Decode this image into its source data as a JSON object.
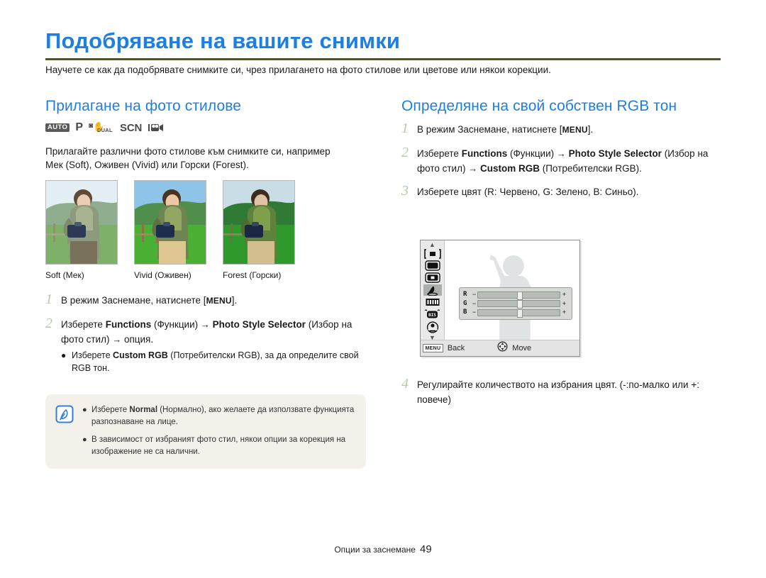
{
  "header": {
    "title": "Подобряване на вашите снимки",
    "intro": "Научете се как да подобрявате снимките си, чрез прилагането на фото стилове или цветове или някои корекции."
  },
  "left_column": {
    "section_title": "Прилагане на фото стилове",
    "modes": [
      {
        "name": "auto-mode-icon",
        "label": "AUTO"
      },
      {
        "name": "program-mode-icon",
        "label": "P"
      },
      {
        "name": "dual-is-mode-icon",
        "label": "DUAL"
      },
      {
        "name": "scene-mode-icon",
        "label": "SCN"
      },
      {
        "name": "movie-mode-icon",
        "label": ""
      }
    ],
    "description": "Прилагайте различни фото стилове към снимките си, например Мек (Soft), Оживен (Vivid) или Горски (Forest).",
    "thumbnails": [
      {
        "caption": "Soft (Мек)",
        "sky": "#e4eef5",
        "hill": "#8fae8e",
        "grass": "#7fb06a",
        "vest": "#8d9a7e",
        "skin": "#e8cdb6"
      },
      {
        "caption": "Vivid (Оживен)",
        "sky": "#8ec4e8",
        "hill": "#4f8f4b",
        "grass": "#49b033",
        "vest": "#6f8353",
        "skin": "#edc8a4"
      },
      {
        "caption": "Forest (Горски)",
        "sky": "#c8dde6",
        "hill": "#2f7a35",
        "grass": "#2f9a2b",
        "vest": "#60813e",
        "skin": "#dfc2a3"
      }
    ],
    "steps": [
      {
        "num": "1",
        "parts": [
          {
            "t": "text",
            "v": "В режим Заснемане, натиснете ["
          },
          {
            "t": "key",
            "v": "MENU"
          },
          {
            "t": "text",
            "v": "]."
          }
        ]
      },
      {
        "num": "2",
        "parts": [
          {
            "t": "text",
            "v": "Изберете "
          },
          {
            "t": "bold",
            "v": "Functions"
          },
          {
            "t": "text",
            "v": " (Функции) "
          },
          {
            "t": "arrow",
            "v": "→"
          },
          {
            "t": "text",
            "v": " "
          },
          {
            "t": "bold",
            "v": "Photo Style Selector"
          },
          {
            "t": "text",
            "v": " (Избор на фото стил) "
          },
          {
            "t": "arrow",
            "v": "→"
          },
          {
            "t": "text",
            "v": " опция."
          }
        ],
        "sub": [
          {
            "parts": [
              {
                "t": "text",
                "v": "Изберете "
              },
              {
                "t": "bold",
                "v": "Custom RGB"
              },
              {
                "t": "text",
                "v": " (Потребителски RGB), за да определите свой RGB тон."
              }
            ]
          }
        ]
      }
    ]
  },
  "note": {
    "icon": "note-pen-icon",
    "items": [
      {
        "parts": [
          {
            "t": "text",
            "v": "Изберете "
          },
          {
            "t": "bold",
            "v": "Normal"
          },
          {
            "t": "text",
            "v": " (Нормално), ако желаете да използвате функцията разпознаване на лице."
          }
        ]
      },
      {
        "parts": [
          {
            "t": "text",
            "v": "В зависимост от избраният фото стил, някои опции за корекция на изображение не са налични."
          }
        ]
      }
    ]
  },
  "right_column": {
    "section_title": "Определяне на свой собствен RGB тон",
    "steps": [
      {
        "num": "1",
        "parts": [
          {
            "t": "text",
            "v": "В режим Заснемане, натиснете ["
          },
          {
            "t": "key",
            "v": "MENU"
          },
          {
            "t": "text",
            "v": "]."
          }
        ]
      },
      {
        "num": "2",
        "parts": [
          {
            "t": "text",
            "v": "Изберете "
          },
          {
            "t": "bold",
            "v": "Functions"
          },
          {
            "t": "text",
            "v": " (Функции) "
          },
          {
            "t": "arrow",
            "v": "→"
          },
          {
            "t": "text",
            "v": " "
          },
          {
            "t": "bold",
            "v": "Photo Style Selector"
          },
          {
            "t": "text",
            "v": " (Избор на фото стил) "
          },
          {
            "t": "arrow",
            "v": "→"
          },
          {
            "t": "text",
            "v": " "
          },
          {
            "t": "bold",
            "v": "Custom RGB"
          },
          {
            "t": "text",
            "v": " (Потребителски RGB)."
          }
        ]
      },
      {
        "num": "3",
        "parts": [
          {
            "t": "text",
            "v": "Изберете цвят (R: Червено, G: Зелено, B: Синьо)."
          }
        ]
      },
      {
        "num": "4",
        "parts": [
          {
            "t": "text",
            "v": "Регулирайте количеството на избрания цвят. (-:по-малко или +: повече)"
          }
        ]
      }
    ]
  },
  "lcd": {
    "sidebar_icons": [
      "chevron-up-icon",
      "focus-frame-icon",
      "image-size-icon",
      "image-quality-icon",
      "photo-style-icon",
      "exposure-bracket-icon",
      "image-stabilizer-icon",
      "face-detection-icon",
      "chevron-down-icon"
    ],
    "selected_icon_index": 4,
    "rgb_rows": [
      {
        "label": "R",
        "minus": "−",
        "plus": "+",
        "value": 50
      },
      {
        "label": "G",
        "minus": "−",
        "plus": "+",
        "value": 50
      },
      {
        "label": "B",
        "minus": "−",
        "plus": "+",
        "value": 50
      }
    ],
    "footer": {
      "menu_key": "MENU",
      "back_label": "Back",
      "move_label": "Move",
      "dpad_icon": "dpad-icon"
    }
  },
  "footer": {
    "section": "Опции за заснемане",
    "page": "49"
  },
  "colors": {
    "accent_blue": "#1f7fe0",
    "rule_olive": "#55502f",
    "step_number": "#b9c9a9",
    "note_bg": "#f4f1ea",
    "note_icon_blue": "#2f7fe0"
  }
}
